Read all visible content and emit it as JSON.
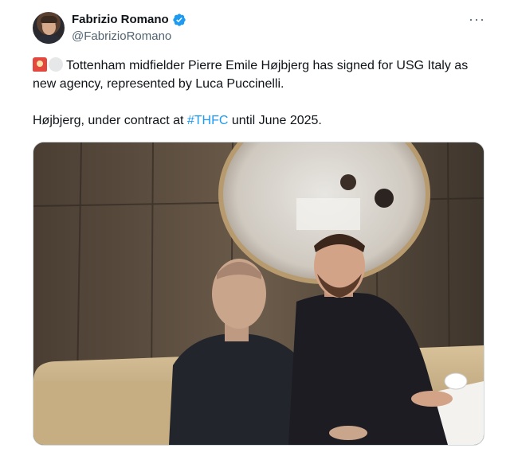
{
  "tweet": {
    "author": {
      "display_name": "Fabrizio Romano",
      "handle": "@FabrizioRomano",
      "verified": true,
      "verified_color": "#1d9bf0"
    },
    "more_label": "···",
    "text_line1": "Tottenham midfielder Pierre Emile Højbjerg has signed for USG Italy as new agency, represented by Luca Puccinelli.",
    "text_line2_prefix": "Højbjerg, under contract at ",
    "hashtag": "#THFC",
    "text_line2_suffix": " until June 2025.",
    "emojis": [
      "siren-emoji",
      "white-circle-emoji"
    ],
    "media": {
      "alt": "photo"
    },
    "colors": {
      "text": "#0f1419",
      "secondary": "#536471",
      "link": "#1d9bf0"
    }
  }
}
